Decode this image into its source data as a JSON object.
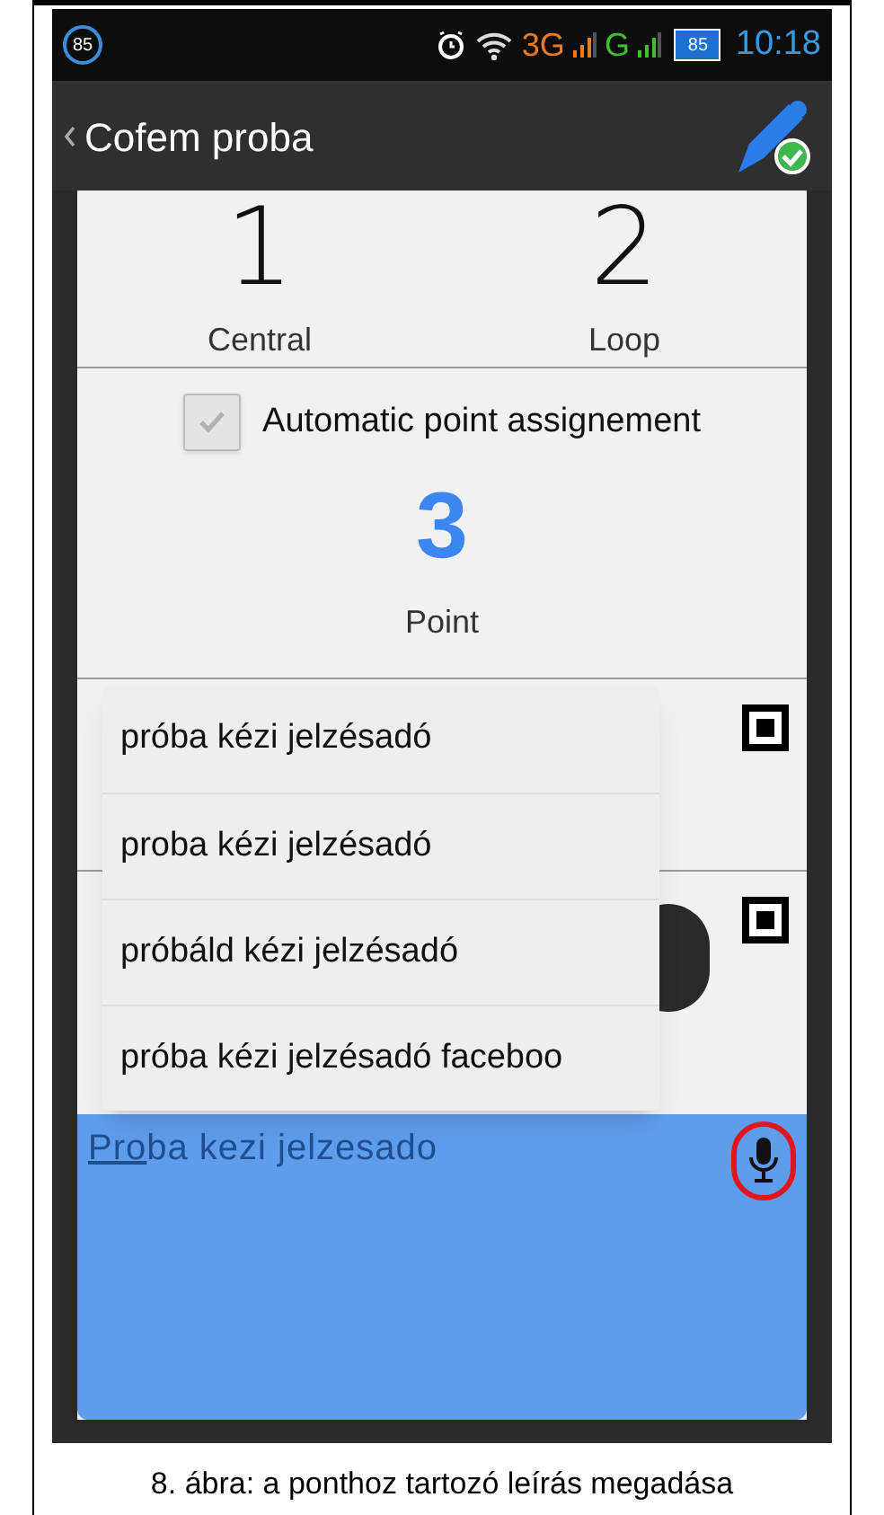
{
  "status_bar": {
    "notification_count": "85",
    "network_1": "3G",
    "network_2": "G",
    "battery": "85",
    "time": "10:18"
  },
  "action_bar": {
    "title": "Cofem proba"
  },
  "counters": [
    {
      "number": "1",
      "label": "Central"
    },
    {
      "number": "2",
      "label": "Loop"
    }
  ],
  "auto_assign": {
    "label": "Automatic point assignement",
    "checked": true
  },
  "point": {
    "number": "3",
    "label": "Point"
  },
  "suggestions": [
    "próba kézi jelzésadó",
    "proba kézi jelzésadó",
    "próbáld kézi jelzésadó",
    "próba kézi jelzésadó faceboo"
  ],
  "description_field": {
    "value_composing": "Pro",
    "value_rest": "ba kezi jelzesado"
  },
  "caption": "8. ábra: a ponthoz tartozó leírás megadása"
}
